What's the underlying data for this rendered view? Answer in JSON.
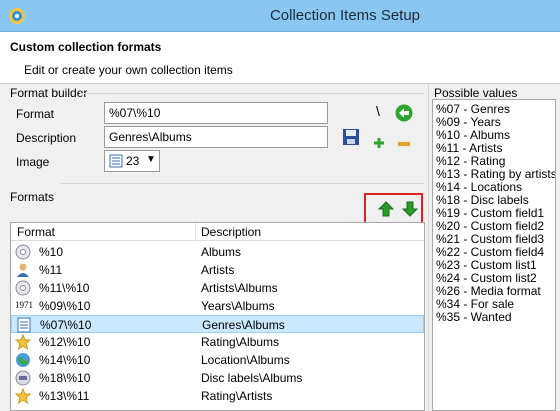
{
  "window": {
    "title": "Collection Items Setup"
  },
  "header": {
    "title": "Custom collection formats",
    "subtitle": "Edit or create your own collection items"
  },
  "format_builder": {
    "section_label": "Format builder",
    "format_label": "Format",
    "format_value": "%07\\%10",
    "description_label": "Description",
    "description_value": "Genres\\Albums",
    "image_label": "Image",
    "image_value": "23",
    "backslash_label": "\\"
  },
  "formats": {
    "section_label": "Formats",
    "columns": [
      "Format",
      "Description"
    ],
    "rows": [
      {
        "icon": "cd-disc-icon",
        "format": "%10",
        "description": "Albums"
      },
      {
        "icon": "person-icon",
        "format": "%11",
        "description": "Artists"
      },
      {
        "icon": "cd-disc-icon",
        "format": "%11\\%10",
        "description": "Artists\\Albums"
      },
      {
        "icon": "year-icon",
        "year_text": "1971",
        "format": "%09\\%10",
        "description": "Years\\Albums"
      },
      {
        "icon": "document-list-icon",
        "format": "%07\\%10",
        "description": "Genres\\Albums",
        "selected": true
      },
      {
        "icon": "star-icon",
        "format": "%12\\%10",
        "description": "Rating\\Albums"
      },
      {
        "icon": "globe-icon",
        "format": "%14\\%10",
        "description": "Location\\Albums"
      },
      {
        "icon": "disc-label-icon",
        "format": "%18\\%10",
        "description": "Disc labels\\Albums"
      },
      {
        "icon": "star-icon",
        "format": "%13\\%11",
        "description": "Rating\\Artists"
      }
    ]
  },
  "possible_values": {
    "label": "Possible values",
    "items": [
      "%07 - Genres",
      "%09 - Years",
      "%10 - Albums",
      "%11 - Artists",
      "%12 - Rating",
      "%13 - Rating by artists",
      "%14 - Locations",
      "%18 - Disc labels",
      "%19 - Custom field1",
      "%20 - Custom field2",
      "%21 - Custom field3",
      "%22 - Custom field4",
      "%23 - Custom list1",
      "%24 - Custom list2",
      "%26 - Media format",
      "%34 - For sale",
      "%35 - Wanted"
    ]
  },
  "colors": {
    "titlebar": "#89c7f2",
    "selection": "#cce8ff",
    "arrow_green": "#2a9a2a",
    "highlight_box": "#e02020",
    "minus_orange": "#e8a02a"
  }
}
